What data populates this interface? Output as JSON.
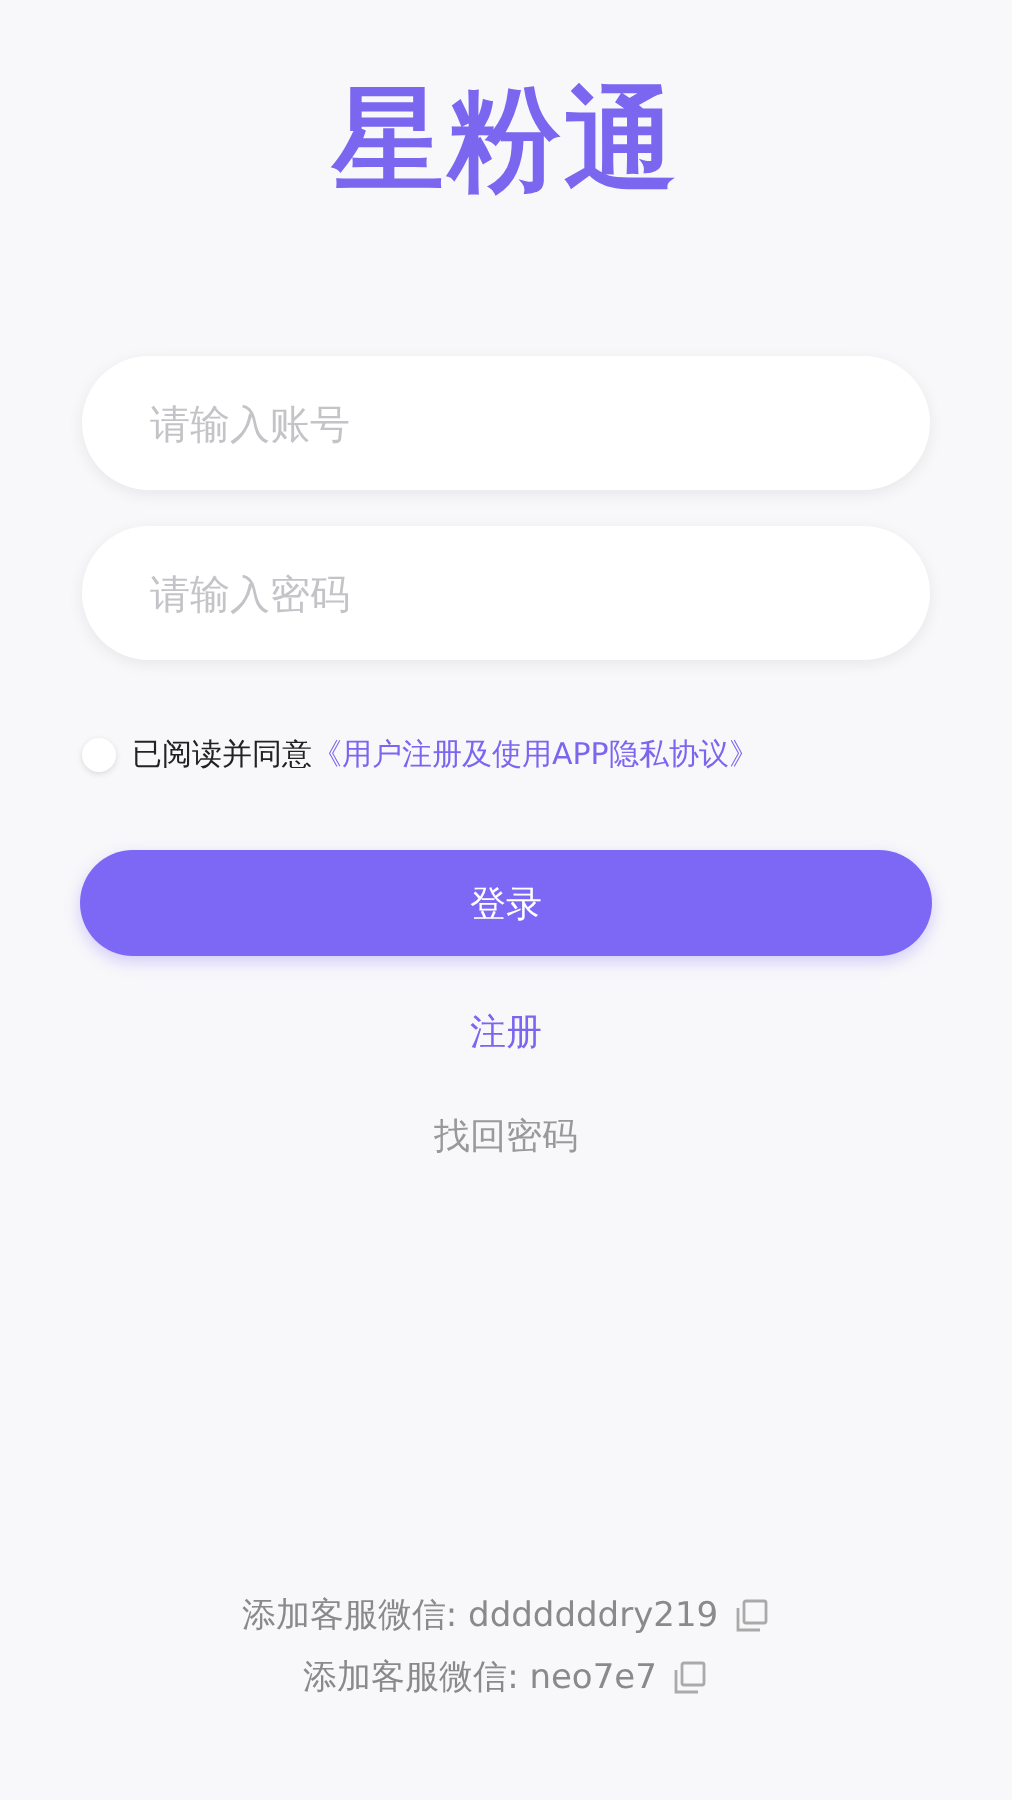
{
  "logo": "星粉通",
  "fields": [
    {
      "placeholder": "请输入账号"
    },
    {
      "placeholder": "请输入密码"
    }
  ],
  "agreement": {
    "checked": false,
    "text": "已阅读并同意",
    "link": "《用户注册及使用APP隐私协议》"
  },
  "login_button": "登录",
  "register_link": "注册",
  "forgot_link": "找回密码",
  "contacts": [
    {
      "label": "添加客服微信: dddddddry219"
    },
    {
      "label": "添加客服微信: neo7e7"
    }
  ]
}
